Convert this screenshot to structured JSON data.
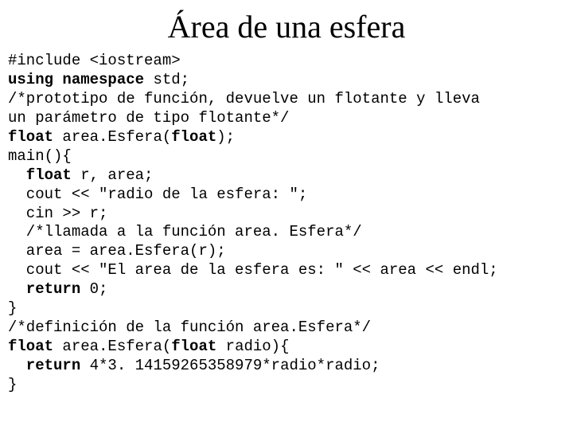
{
  "title": "Área de una esfera",
  "code": {
    "l1a": "#include <iostream>",
    "l2a": "using namespace ",
    "l2b": "std;",
    "l3a": "/*prototipo de función, devuelve un flotante y lleva",
    "l4a": "un parámetro de tipo flotante*/",
    "l5a": "float ",
    "l5b": "area.Esfera(",
    "l5c": "float",
    "l5d": ");",
    "l6a": "main(){",
    "l7a": "  float ",
    "l7b": "r, area;",
    "l8a": "  cout << \"radio de la esfera: \";",
    "l9a": "  cin >> r;",
    "l10a": "  /*llamada a la función area. Esfera*/",
    "l11a": "  area = area.Esfera(r);",
    "l12a": "  cout << \"El area de la esfera es: \" << area << endl;",
    "l13a": "  return ",
    "l13b": "0;",
    "l14a": "}",
    "l15a": "/*definición de la función area.Esfera*/",
    "l16a": "float ",
    "l16b": "area.Esfera(",
    "l16c": "float ",
    "l16d": "radio){",
    "l17a": "  return ",
    "l17b": "4*3. 14159265358979*radio*radio;",
    "l18a": "}"
  }
}
